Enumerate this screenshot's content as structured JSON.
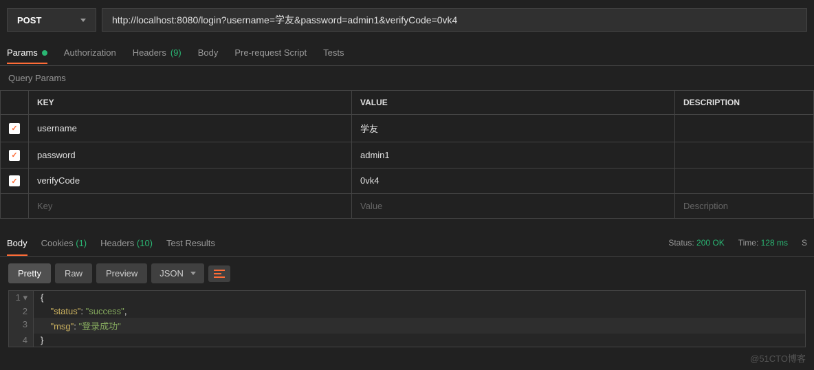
{
  "request": {
    "method": "POST",
    "url": "http://localhost:8080/login?username=学友&password=admin1&verifyCode=0vk4"
  },
  "request_tabs": {
    "params": "Params",
    "authorization": "Authorization",
    "headers": "Headers",
    "headers_count": "(9)",
    "body": "Body",
    "prerequest": "Pre-request Script",
    "tests": "Tests"
  },
  "query_section_title": "Query Params",
  "columns": {
    "key": "KEY",
    "value": "VALUE",
    "description": "DESCRIPTION"
  },
  "params": [
    {
      "key": "username",
      "value": "学友",
      "checked": true
    },
    {
      "key": "password",
      "value": "admin1",
      "checked": true
    },
    {
      "key": "verifyCode",
      "value": "0vk4",
      "checked": true
    }
  ],
  "placeholders": {
    "key": "Key",
    "value": "Value",
    "description": "Description"
  },
  "response_tabs": {
    "body": "Body",
    "cookies": "Cookies",
    "cookies_count": "(1)",
    "headers": "Headers",
    "headers_count": "(10)",
    "tests": "Test Results"
  },
  "status": {
    "status_label": "Status:",
    "status_value": "200 OK",
    "time_label": "Time:",
    "time_value": "128 ms",
    "extra": "S"
  },
  "view_buttons": {
    "pretty": "Pretty",
    "raw": "Raw",
    "preview": "Preview",
    "format": "JSON"
  },
  "json_body": {
    "l1": "{",
    "l2_key": "\"status\"",
    "l2_val": "\"success\"",
    "l3_key": "\"msg\"",
    "l3_val": "\"登录成功\"",
    "l4": "}"
  },
  "watermark": "@51CTO博客"
}
